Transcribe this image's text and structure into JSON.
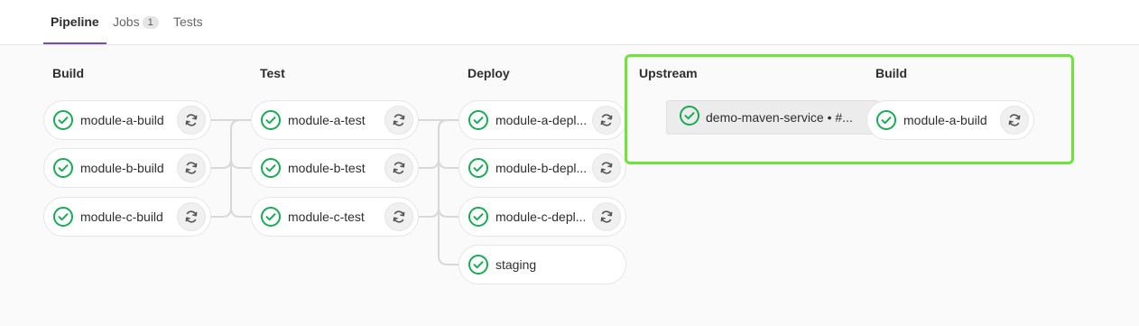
{
  "tabs": {
    "pipeline": "Pipeline",
    "jobs": "Jobs",
    "jobs_count": "1",
    "tests": "Tests"
  },
  "stages": {
    "build": "Build",
    "test": "Test",
    "deploy": "Deploy",
    "upstream": "Upstream",
    "downstream_build": "Build"
  },
  "jobs": {
    "build": [
      "module-a-build",
      "module-b-build",
      "module-c-build"
    ],
    "test": [
      "module-a-test",
      "module-b-test",
      "module-c-test"
    ],
    "deploy": [
      "module-a-depl...",
      "module-b-depl...",
      "module-c-depl...",
      "staging"
    ],
    "upstream": "demo-maven-service • #...",
    "downstream_build": "module-a-build"
  },
  "colors": {
    "success": "#1aaa55",
    "accent": "#6b4fbb",
    "highlight": "#6be53a"
  },
  "icons": {
    "status": "status-success-icon",
    "retry": "retry-icon"
  }
}
